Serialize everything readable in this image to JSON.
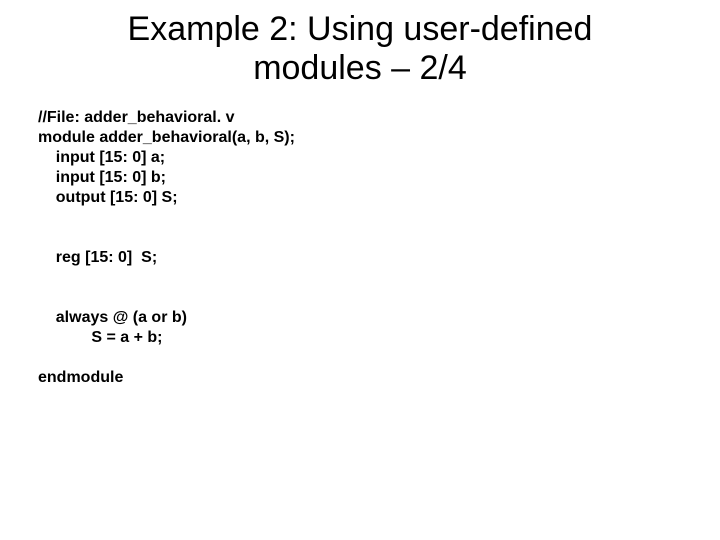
{
  "title_line1": "Example 2: Using user-defined",
  "title_line2": "modules – 2/4",
  "code": {
    "l1": "//File: adder_behavioral. v",
    "l2": "module adder_behavioral(a, b, S);",
    "l3": "    input [15: 0] a;",
    "l4": "    input [15: 0] b;",
    "l5": "    output [15: 0] S;",
    "l6": "",
    "l7": "",
    "l8": "    reg [15: 0]  S;",
    "l9": "",
    "l10": "",
    "l11": "    always @ (a or b)",
    "l12": "            S = a + b;",
    "l13": "",
    "l14": "endmodule"
  }
}
